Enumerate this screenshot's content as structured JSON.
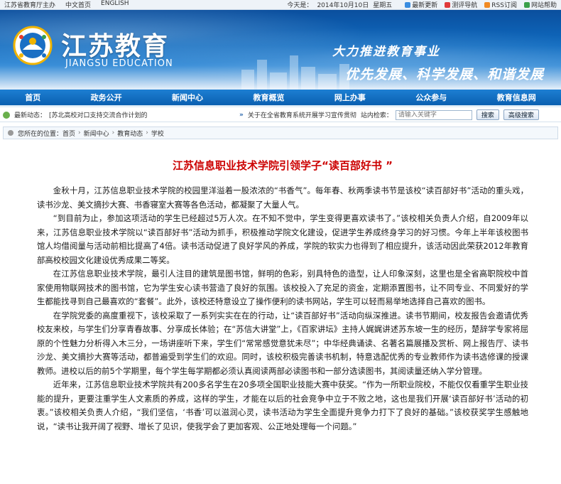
{
  "topbar": {
    "org_link": "江苏省教育厅主办",
    "cn_link": "中文首页",
    "en_link": "ENGLISH",
    "date_label": "今天是：",
    "date_value": "2014年10月10日",
    "weekday": "星期五",
    "tools": [
      {
        "label": "最新更新",
        "icon": "refresh-icon",
        "color": "#3a8de0"
      },
      {
        "label": "测评导航",
        "icon": "flag-icon",
        "color": "#e03a3a"
      },
      {
        "label": "RSS订阅",
        "icon": "rss-icon",
        "color": "#f08a24"
      },
      {
        "label": "网站帮助",
        "icon": "help-icon",
        "color": "#3aa04a"
      }
    ]
  },
  "banner": {
    "logo_cn": "江苏教育",
    "logo_en": "JIANGSU EDUCATION",
    "slogan1": "大力推进教育事业",
    "slogan2": "优先发展、科学发展、和谐发展"
  },
  "nav": {
    "items": [
      "首页",
      "政务公开",
      "新闻中心",
      "教育概览",
      "网上办事",
      "公众参与",
      "教育信息网"
    ]
  },
  "ticker": {
    "label": "最新动态：",
    "news": "[苏北高校对口支持交流合作计划的",
    "notice": "关于在全省教育系统开展学习宣传贯彻",
    "search_label": "站内检索：",
    "search_placeholder": "请输入关键字",
    "search_button": "搜索",
    "advanced_button": "高级搜索"
  },
  "breadcrumb": {
    "label": "您所在的位置：",
    "items": [
      "首页",
      "新闻中心",
      "教育动态",
      "学校"
    ]
  },
  "article": {
    "title": "江苏信息职业技术学院引领学子“读百部好书 ”",
    "paragraphs": [
      "金秋十月，江苏信息职业技术学院的校园里洋溢着一股浓浓的“书香气”。每年春、秋两季读书节是该校“读百部好书”活动的重头戏，读书沙龙、美文摘抄大赛、书香寝室大赛等各色活动，都凝聚了大量人气。",
      "“到目前为止，参加这项活动的学生已经超过5万人次。在不知不觉中，学生变得更喜欢读书了。”该校相关负责人介绍，自2009年以来，江苏信息职业技术学院以“读百部好书”活动为抓手，积极推动学院文化建设，促进学生养成终身学习的好习惯。今年上半年该校图书馆人均借阅量与活动前相比提高了4倍。读书活动促进了良好学风的养成，学院的软实力也得到了相应提升，该活动因此荣获2012年教育部高校校园文化建设优秀成果二等奖。",
      "在江苏信息职业技术学院，最引人注目的建筑是图书馆，鲜明的色彩，别具特色的造型，让人印象深刻，这里也是全省高职院校中首家使用物联网技术的图书馆，它为学生安心读书营造了良好的氛围。该校投入了充足的资金，定期添置图书，让不同专业、不同爱好的学生都能找寻到自己最喜欢的“套餐”。此外，该校还特意设立了操作便利的读书网站，学生可以轻而易举地选择自己喜欢的图书。",
      "在学院党委的高度重视下，该校采取了一系列实实在在的行动，让“读百部好书”活动向纵深推进。读书节期间，校友报告会邀请优秀校友来校，与学生们分享青春故事、分享成长体验；在“苏信大讲堂”上，《百家讲坛》主持人娓娓讲述苏东坡一生的经历，楚辞学专家将屈原的个性魅力分析得入木三分，一场讲座听下来，学生们“常常感觉意犹未尽”；中华经典诵读、名著名篇展播及赏析、网上报告厅、读书沙龙、美文摘抄大赛等活动，都普遍受到学生们的欢迎。同时，该校积极完善读书机制，特意选配优秀的专业教师作为读书选修课的授课教师。进校以后的前5个学期里，每个学生每学期都必须认真阅读两部必读图书和一部分选读图书，其阅读量还纳入学分管理。",
      "近年来，江苏信息职业技术学院共有200多名学生在20多项全国职业技能大赛中获奖。“作为一所职业院校，不能仅仅看重学生职业技能的提升，更要注重学生人文素质的养成，这样的学生，才能在以后的社会竞争中立于不败之地，这也是我们开展‘读百部好书’活动的初衷。”该校相关负责人介绍，“我们坚信，‘书香’可以滋润心灵，读书活动为学生全面提升竞争力打下了良好的基础。”该校获奖学生感触地说，“读书让我开阔了视野、增长了见识，使我学会了更加客观、公正地处理每一个问题。”"
    ]
  }
}
